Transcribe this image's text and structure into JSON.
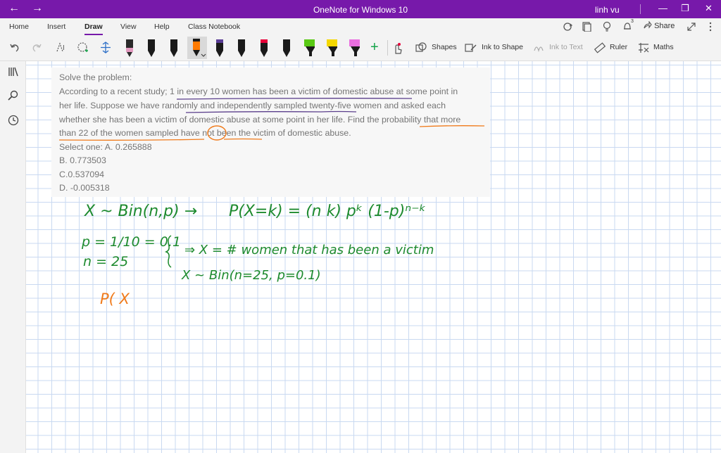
{
  "window": {
    "title": "OneNote for Windows 10",
    "user": "linh vu",
    "back_icon": "←",
    "forward_icon": "→",
    "minimize_icon": "—",
    "restore_icon": "❐",
    "close_icon": "✕"
  },
  "ribbon": {
    "tabs": [
      "Home",
      "Insert",
      "Draw",
      "View",
      "Help",
      "Class Notebook"
    ],
    "active_tab": "Draw",
    "share_label": "Share",
    "notification_count": "3"
  },
  "toolbar": {
    "shapes_label": "Shapes",
    "ink_to_shape_label": "Ink to Shape",
    "ink_to_text_label": "Ink to Text",
    "ruler_label": "Ruler",
    "maths_label": "Maths",
    "pen_colors": [
      "#e39ac0",
      "#1a1a1a",
      "#1a1a1a",
      "#ff7a00",
      "#5a3d96",
      "#1a1a1a",
      "#1a1a1a",
      "#e8003a",
      "#1a1a1a",
      "#1a1a1a",
      "#59c914",
      "#f5d800",
      "#f5d800",
      "#ea6fe0"
    ]
  },
  "note": {
    "lines": [
      "Solve the problem:",
      "According to a recent study; 1 in every 10 women has been a victim of domestic abuse at some point in",
      "her life. Suppose we have randomly and independently sampled twenty-five women and asked each",
      "whether she has been a victim of domestic abuse at some point in her life. Find the probability that more",
      "than 22 of the women sampled have not been the victim of domestic abuse.",
      "Select one: A. 0.265888",
      "B. 0.773503",
      "C.0.537094",
      "D. -0.005318"
    ]
  },
  "handwriting": {
    "line1_left": "X ~ Bin(n,p) →",
    "line1_right": "P(X=k) = (n k) pᵏ (1-p)ⁿ⁻ᵏ",
    "line2": "p = 1/10 = 0.1",
    "line3": "n = 25",
    "line4": "⇒ X = # women that has been a victim",
    "line5": "X ~ Bin(n=25, p=0.1)",
    "line6": "P( X",
    "ink_green": "#1d8a2e",
    "ink_orange": "#f07a1a",
    "ink_purple": "#5b3f8c"
  }
}
